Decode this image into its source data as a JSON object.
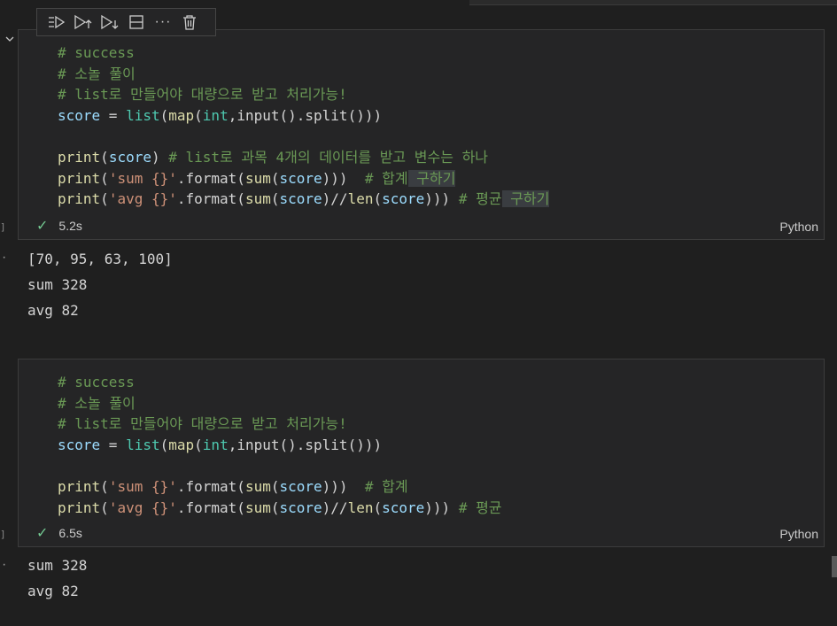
{
  "toolbar": {
    "icons": [
      "execute-above-icon",
      "run-above-icon",
      "run-below-icon",
      "split-cell-icon",
      "more-icon",
      "delete-icon"
    ],
    "more_glyph": "···"
  },
  "cell1": {
    "exec_bracket": "]",
    "code": {
      "c1": "# success",
      "c2": "# 소놀 풀이",
      "c3": "# list로 만들어야 대량으로 받고 처리가능!",
      "l4": {
        "var": "score",
        "eq": " = ",
        "list": "list",
        "p1": "(",
        "map": "map",
        "p2": "(",
        "int": "int",
        "rest": ",input().split()))"
      },
      "l6": {
        "print": "print",
        "p1": "(",
        "score": "score",
        "p2": ")",
        "sp": " ",
        "cm": "# list로 과목 4개의 데이터를 받고 변수는 하나"
      },
      "l7": {
        "print": "print",
        "p1": "(",
        "str": "'sum {}'",
        "fmt": ".format(",
        "sum": "sum",
        "p2": "(",
        "score": "score",
        "p3": ")))  ",
        "cm": "# 합계",
        "cmhl": " 구하기"
      },
      "l8": {
        "print": "print",
        "p1": "(",
        "str": "'avg {}'",
        "fmt": ".format(",
        "sum": "sum",
        "p2": "(",
        "score": "score",
        "p3": ")//",
        "len": "len",
        "p4": "(",
        "score2": "score",
        "p5": "))) ",
        "cm": "# 평균",
        "cmhl": " 구하기"
      }
    },
    "status_time": "5.2s",
    "language": "Python",
    "output": [
      "[70, 95, 63, 100]",
      "sum 328",
      "avg 82"
    ]
  },
  "cell2": {
    "exec_bracket": "]",
    "code": {
      "c1": "# success",
      "c2": "# 소놀 풀이",
      "c3": "# list로 만들어야 대량으로 받고 처리가능!",
      "l4": {
        "var": "score",
        "eq": " = ",
        "list": "list",
        "p1": "(",
        "map": "map",
        "p2": "(",
        "int": "int",
        "rest": ",input().split()))"
      },
      "l6": {
        "print": "print",
        "p1": "(",
        "str": "'sum {}'",
        "fmt": ".format(",
        "sum": "sum",
        "p2": "(",
        "score": "score",
        "p3": ")))  ",
        "cm": "# 합계"
      },
      "l7": {
        "print": "print",
        "p1": "(",
        "str": "'avg {}'",
        "fmt": ".format(",
        "sum": "sum",
        "p2": "(",
        "score": "score",
        "p3": ")//",
        "len": "len",
        "p4": "(",
        "score2": "score",
        "p5": "))) ",
        "cm": "# 평균"
      }
    },
    "status_time": "6.5s",
    "language": "Python",
    "output": [
      "sum 328",
      "avg 82"
    ]
  },
  "colors": {
    "comment": "#6a9955",
    "function": "#dcdcaa",
    "variable": "#9cdcfe",
    "type": "#4ec9b0",
    "string": "#ce9178",
    "success": "#73c991"
  }
}
